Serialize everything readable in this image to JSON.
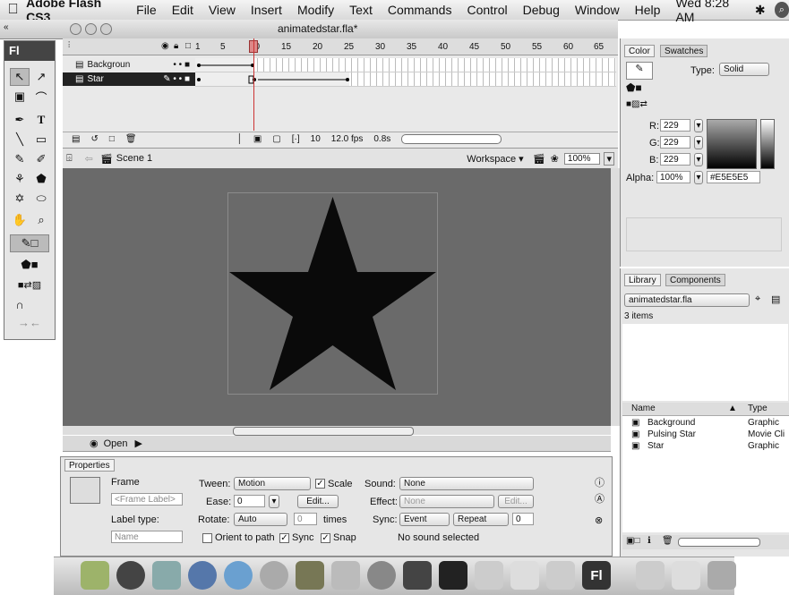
{
  "menubar": {
    "app": "Adobe Flash CS3",
    "items": [
      "File",
      "Edit",
      "View",
      "Insert",
      "Modify",
      "Text",
      "Commands",
      "Control",
      "Debug",
      "Window",
      "Help"
    ],
    "clock": "Wed 8:28 AM"
  },
  "document": {
    "title": "animatedstar.fla*"
  },
  "tools": {
    "header": "Fl"
  },
  "timeline": {
    "ruler": [
      "1",
      "5",
      "10",
      "15",
      "20",
      "25",
      "30",
      "35",
      "40",
      "45",
      "50",
      "55",
      "60",
      "65"
    ],
    "layers": [
      {
        "name": "Backgroun",
        "selected": false
      },
      {
        "name": "Star",
        "selected": true
      }
    ],
    "current_frame": "10",
    "fps": "12.0 fps",
    "time": "0.8s"
  },
  "editbar": {
    "scene": "Scene 1",
    "workspace": "Workspace ▾",
    "zoom": "100%"
  },
  "actionsbar": {
    "label": "Open"
  },
  "properties": {
    "tab": "Properties",
    "frame_label": "Frame",
    "frame_label_placeholder": "<Frame Label>",
    "label_type_label": "Label type:",
    "label_type_value": "Name",
    "tween_label": "Tween:",
    "tween_value": "Motion",
    "scale_label": "Scale",
    "ease_label": "Ease:",
    "ease_value": "0",
    "edit_label": "Edit...",
    "rotate_label": "Rotate:",
    "rotate_value": "Auto",
    "times_value": "0",
    "times_label": "times",
    "orient_label": "Orient to path",
    "sync_label": "Sync",
    "snap_label": "Snap",
    "sound_label": "Sound:",
    "sound_value": "None",
    "effect_label": "Effect:",
    "effect_value": "None",
    "sync_sound_label": "Sync:",
    "sync_sound_value": "Event",
    "repeat_value": "Repeat",
    "repeat_count": "0",
    "no_sound": "No sound selected"
  },
  "color": {
    "tabs": [
      "Color",
      "Swatches"
    ],
    "type_label": "Type:",
    "type_value": "Solid",
    "r_label": "R:",
    "r": "229",
    "g_label": "G:",
    "g": "229",
    "b_label": "B:",
    "b": "229",
    "alpha_label": "Alpha:",
    "alpha": "100%",
    "hex": "#E5E5E5"
  },
  "library": {
    "tabs": [
      "Library",
      "Components"
    ],
    "file": "animatedstar.fla",
    "count": "3 items",
    "col_name": "Name",
    "col_type": "Type",
    "items": [
      {
        "name": "Background",
        "type": "Graphic"
      },
      {
        "name": "Pulsing Star",
        "type": "Movie Cli"
      },
      {
        "name": "Star",
        "type": "Graphic"
      }
    ]
  },
  "dock": {
    "flash_label": "Fl"
  },
  "colors": {
    "stage_bg": "#6a6a6a",
    "star": "#0a0a0a",
    "selected_layer": "#222222"
  }
}
